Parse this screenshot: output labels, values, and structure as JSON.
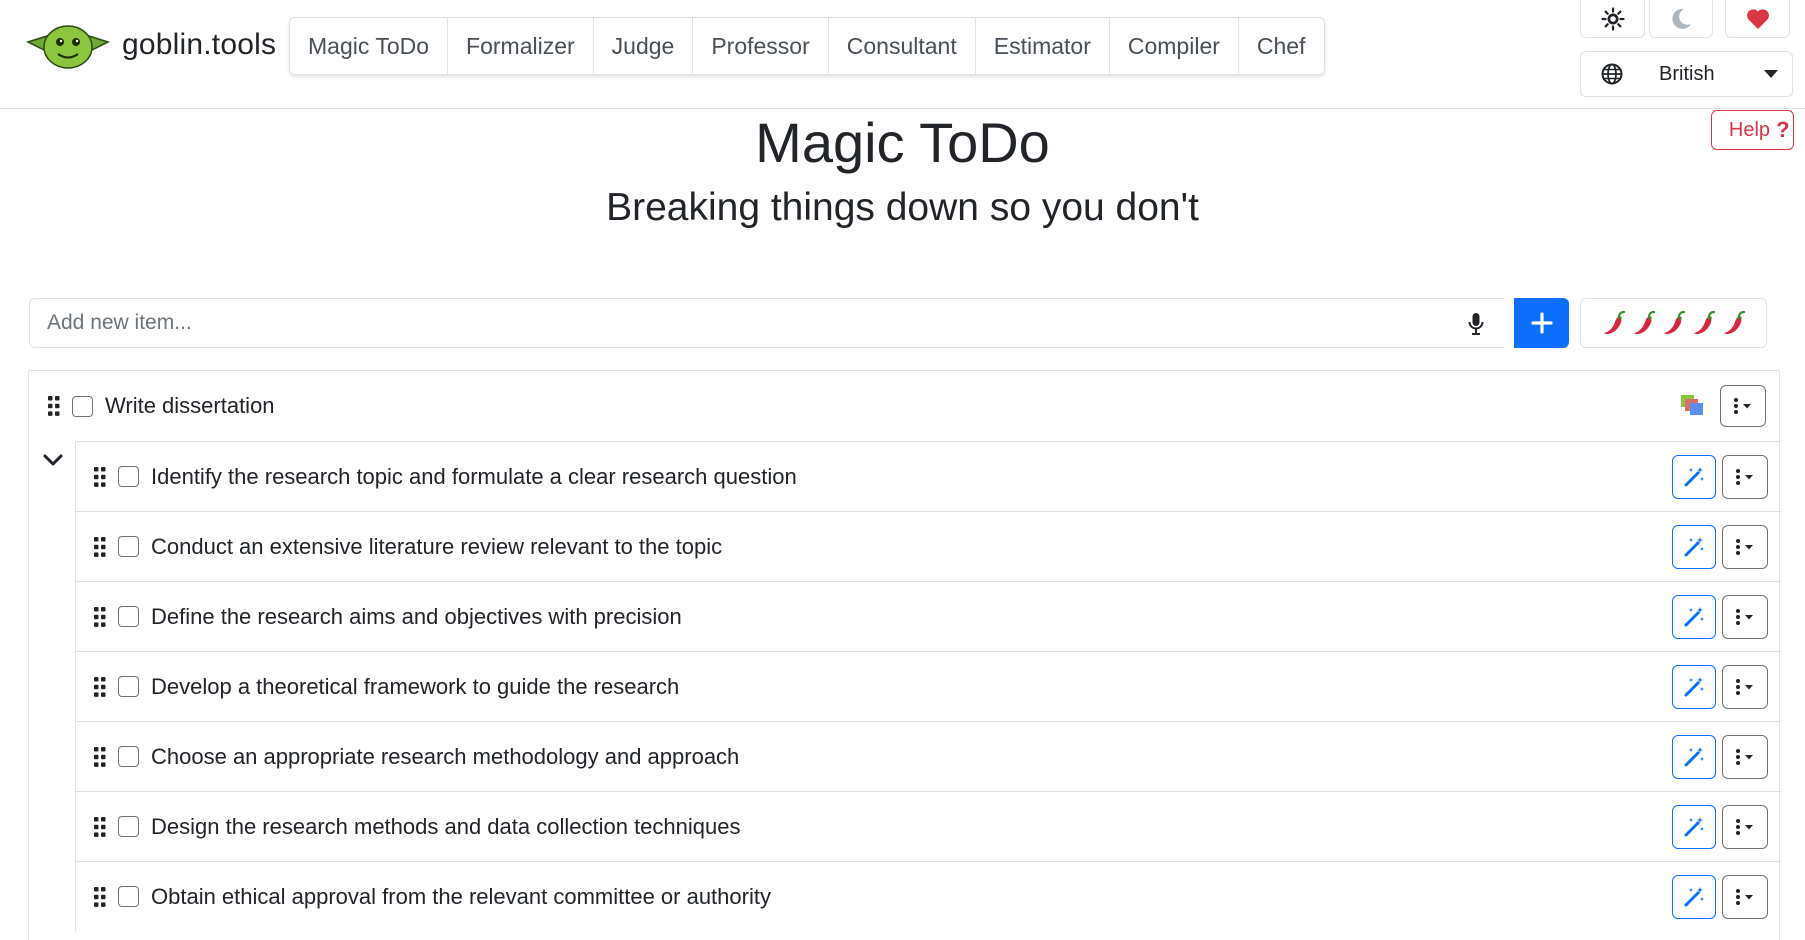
{
  "brand": {
    "name": "goblin.tools"
  },
  "nav": {
    "tabs": [
      {
        "label": "Magic ToDo"
      },
      {
        "label": "Formalizer"
      },
      {
        "label": "Judge"
      },
      {
        "label": "Professor"
      },
      {
        "label": "Consultant"
      },
      {
        "label": "Estimator"
      },
      {
        "label": "Compiler"
      },
      {
        "label": "Chef"
      }
    ]
  },
  "toolbar": {
    "light_icon": "sun-icon",
    "dark_icon": "moon-icon",
    "support_icon": "heart-icon",
    "language": "British",
    "help_label": "Help",
    "help_symbol": "?"
  },
  "page": {
    "title": "Magic ToDo",
    "subtitle": "Breaking things down so you don't"
  },
  "add_item": {
    "placeholder": "Add new item...",
    "mic_icon": "microphone-icon",
    "add_icon": "plus-icon",
    "spiciness_icon": "chili-pepper-icon",
    "spiciness_level": 5,
    "spiciness_max": 5
  },
  "tasks": {
    "parent": {
      "text": "Write dissertation",
      "expanded": true
    },
    "subtasks": [
      {
        "text": "Identify the research topic and formulate a clear research question"
      },
      {
        "text": "Conduct an extensive literature review relevant to the topic"
      },
      {
        "text": "Define the research aims and objectives with precision"
      },
      {
        "text": "Develop a theoretical framework to guide the research"
      },
      {
        "text": "Choose an appropriate research methodology and approach"
      },
      {
        "text": "Design the research methods and data collection techniques"
      },
      {
        "text": "Obtain ethical approval from the relevant committee or authority"
      }
    ]
  },
  "colors": {
    "primary": "#0d6efd",
    "danger": "#dc3545",
    "heart": "#dc3545",
    "goblin_green": "#8cc63f",
    "border": "#dee2e6"
  }
}
